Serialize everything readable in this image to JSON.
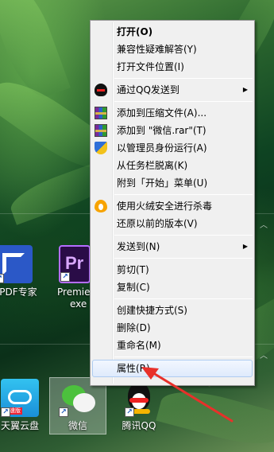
{
  "menu": {
    "items": {
      "open": "打开(O)",
      "compat": "兼容性疑难解答(Y)",
      "open_location": "打开文件位置(I)",
      "send_qq": "通过QQ发送到",
      "add_archive": "添加到压缩文件(A)...",
      "add_rar": "添加到 \"微信.rar\"(T)",
      "run_admin": "以管理员身份运行(A)",
      "unpin_taskbar": "从任务栏脱离(K)",
      "pin_start": "附到「开始」菜单(U)",
      "firewall_scan": "使用火绒安全进行杀毒",
      "restore_prev": "还原以前的版本(V)",
      "send_to": "发送到(N)",
      "cut": "剪切(T)",
      "copy": "复制(C)",
      "create_shortcut": "创建快捷方式(S)",
      "delete": "删除(D)",
      "rename": "重命名(M)",
      "properties": "属性(R)"
    },
    "icons": {
      "send_qq": "qq-penguin-icon",
      "add_archive": "winrar-icon",
      "add_rar": "winrar-icon",
      "run_admin": "uac-shield-icon",
      "firewall_scan": "huorong-icon"
    },
    "highlighted": "properties"
  },
  "desktop": {
    "icons": {
      "pdf": "兴PDF专家",
      "premiere_line1": "Premie",
      "premiere_line2": "exe",
      "premiere_glyph": "Pr",
      "cloud": "天翼云盘",
      "cloud_tag": "极速版",
      "wechat": "微信",
      "qq": "腾讯QQ"
    }
  },
  "colors": {
    "menu_bg": "#f0f0f0",
    "highlight_border": "#aeccf1",
    "annotation_arrow": "#e8302a"
  }
}
